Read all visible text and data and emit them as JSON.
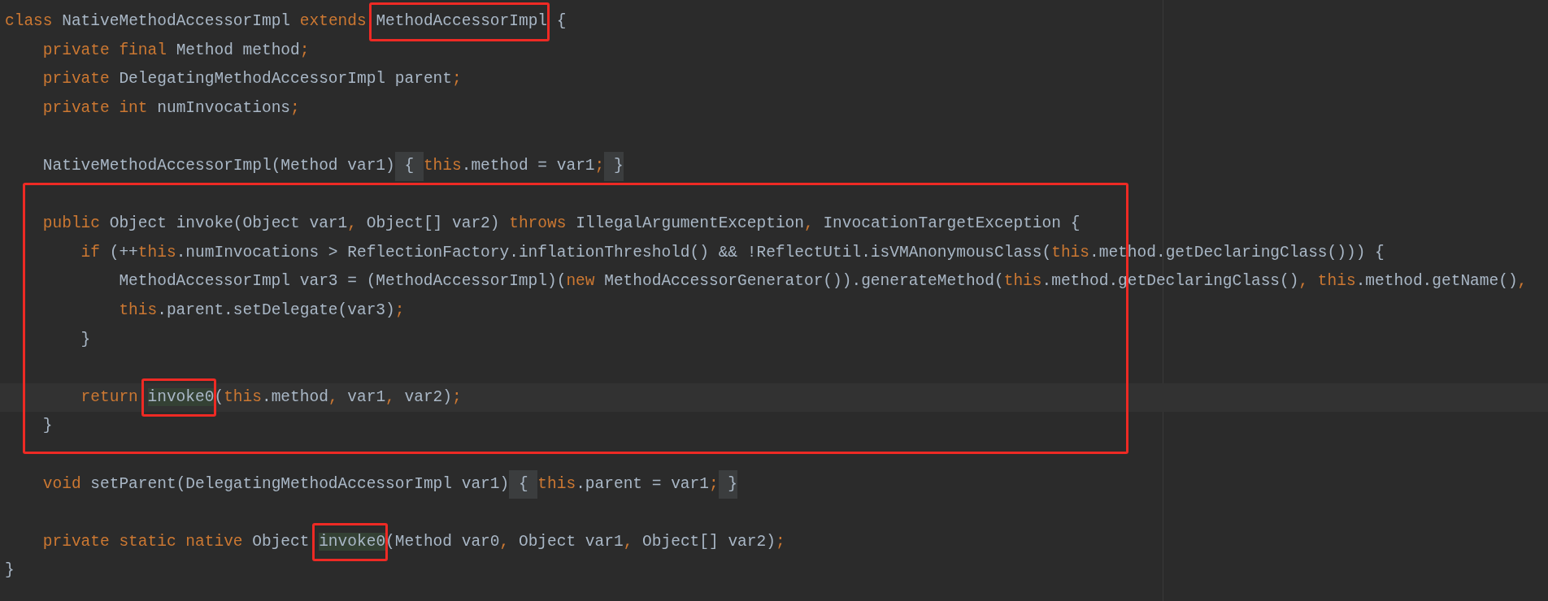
{
  "editor": {
    "lines": [
      {
        "tokens": [
          {
            "kind": "keyword",
            "text": "class "
          },
          {
            "kind": "text",
            "text": "NativeMethodAccessorImpl "
          },
          {
            "kind": "keyword",
            "text": "extends "
          },
          {
            "kind": "text",
            "text": "MethodAccessorImpl",
            "boxed": true
          },
          {
            "kind": "text",
            "text": " {"
          }
        ],
        "children": [
          {
            "tokens": [
              {
                "kind": "keyword",
                "text": "private final "
              },
              {
                "kind": "text",
                "text": "Method method"
              },
              {
                "kind": "punct",
                "text": ";"
              }
            ]
          },
          {
            "tokens": [
              {
                "kind": "keyword",
                "text": "private "
              },
              {
                "kind": "text",
                "text": "DelegatingMethodAccessorImpl parent"
              },
              {
                "kind": "punct",
                "text": ";"
              }
            ]
          },
          {
            "tokens": [
              {
                "kind": "keyword",
                "text": "private int "
              },
              {
                "kind": "text",
                "text": "numInvocations"
              },
              {
                "kind": "punct",
                "text": ";"
              }
            ]
          },
          {
            "kind": "blank"
          },
          {
            "tokens": [
              {
                "kind": "text",
                "text": "NativeMethodAccessorImpl(Method var1)"
              },
              {
                "kind": "fold",
                "text": " { "
              },
              {
                "kind": "keyword",
                "text": "this"
              },
              {
                "kind": "text",
                "text": ".method = var1"
              },
              {
                "kind": "punct",
                "text": ";"
              },
              {
                "kind": "fold",
                "text": " }"
              }
            ]
          },
          {
            "kind": "group",
            "framed": true,
            "lines": [
              {
                "kind": "blank"
              },
              {
                "tokens": [
                  {
                    "kind": "keyword",
                    "text": "public "
                  },
                  {
                    "kind": "text",
                    "text": "Object invoke(Object var1"
                  },
                  {
                    "kind": "punct",
                    "text": ", "
                  },
                  {
                    "kind": "text",
                    "text": "Object[] var2) "
                  },
                  {
                    "kind": "keyword",
                    "text": "throws "
                  },
                  {
                    "kind": "text",
                    "text": "IllegalArgumentException"
                  },
                  {
                    "kind": "punct",
                    "text": ", "
                  },
                  {
                    "kind": "text",
                    "text": "InvocationTargetException {"
                  }
                ],
                "children": [
                  {
                    "tokens": [
                      {
                        "kind": "keyword",
                        "text": "if "
                      },
                      {
                        "kind": "text",
                        "text": "(++"
                      },
                      {
                        "kind": "keyword",
                        "text": "this"
                      },
                      {
                        "kind": "text",
                        "text": ".numInvocations > ReflectionFactory.inflationThreshold() && !ReflectUtil.isVMAnonymousClass("
                      },
                      {
                        "kind": "keyword",
                        "text": "this"
                      },
                      {
                        "kind": "text",
                        "text": ".method.getDeclaringClass())) {"
                      }
                    ],
                    "children": [
                      {
                        "tokens": [
                          {
                            "kind": "text",
                            "text": "MethodAccessorImpl var3 = (MethodAccessorImpl)("
                          },
                          {
                            "kind": "keyword",
                            "text": "new "
                          },
                          {
                            "kind": "text",
                            "text": "MethodAccessorGenerator()).generateMethod("
                          },
                          {
                            "kind": "keyword",
                            "text": "this"
                          },
                          {
                            "kind": "text",
                            "text": ".method.getDeclaringClass()"
                          },
                          {
                            "kind": "punct",
                            "text": ", "
                          },
                          {
                            "kind": "keyword",
                            "text": "this"
                          },
                          {
                            "kind": "text",
                            "text": ".method.getName()"
                          },
                          {
                            "kind": "punct",
                            "text": ","
                          }
                        ]
                      },
                      {
                        "tokens": [
                          {
                            "kind": "keyword",
                            "text": "this"
                          },
                          {
                            "kind": "text",
                            "text": ".parent.setDelegate(var3)"
                          },
                          {
                            "kind": "punct",
                            "text": ";"
                          }
                        ]
                      }
                    ]
                  },
                  {
                    "tokens": [
                      {
                        "kind": "text",
                        "text": "}"
                      }
                    ]
                  },
                  {
                    "kind": "blank"
                  },
                  {
                    "current": true,
                    "tokens": [
                      {
                        "kind": "keyword",
                        "text": "return "
                      },
                      {
                        "kind": "match",
                        "text": "invoke0",
                        "boxed": true
                      },
                      {
                        "kind": "text",
                        "text": "("
                      },
                      {
                        "kind": "keyword",
                        "text": "this"
                      },
                      {
                        "kind": "text",
                        "text": ".method"
                      },
                      {
                        "kind": "punct",
                        "text": ", "
                      },
                      {
                        "kind": "text",
                        "text": "var1"
                      },
                      {
                        "kind": "punct",
                        "text": ", "
                      },
                      {
                        "kind": "text",
                        "text": "var2)"
                      },
                      {
                        "kind": "punct",
                        "text": ";"
                      }
                    ]
                  }
                ]
              },
              {
                "tokens": [
                  {
                    "kind": "text",
                    "text": "}"
                  }
                ]
              }
            ]
          },
          {
            "kind": "blank"
          },
          {
            "tokens": [
              {
                "kind": "keyword",
                "text": "void "
              },
              {
                "kind": "text",
                "text": "setParent(DelegatingMethodAccessorImpl var1)"
              },
              {
                "kind": "fold",
                "text": " { "
              },
              {
                "kind": "keyword",
                "text": "this"
              },
              {
                "kind": "text",
                "text": ".parent = var1"
              },
              {
                "kind": "punct",
                "text": ";"
              },
              {
                "kind": "fold",
                "text": " }"
              }
            ]
          },
          {
            "kind": "blank"
          },
          {
            "tokens": [
              {
                "kind": "keyword",
                "text": "private static native "
              },
              {
                "kind": "text",
                "text": "Object "
              },
              {
                "kind": "match",
                "text": "invoke0",
                "boxed": true
              },
              {
                "kind": "text",
                "text": "(Method var0"
              },
              {
                "kind": "punct",
                "text": ", "
              },
              {
                "kind": "text",
                "text": "Object var1"
              },
              {
                "kind": "punct",
                "text": ", "
              },
              {
                "kind": "text",
                "text": "Object[] var2)"
              },
              {
                "kind": "punct",
                "text": ";"
              }
            ]
          }
        ]
      },
      {
        "tokens": [
          {
            "kind": "text",
            "text": "}"
          }
        ]
      }
    ]
  }
}
